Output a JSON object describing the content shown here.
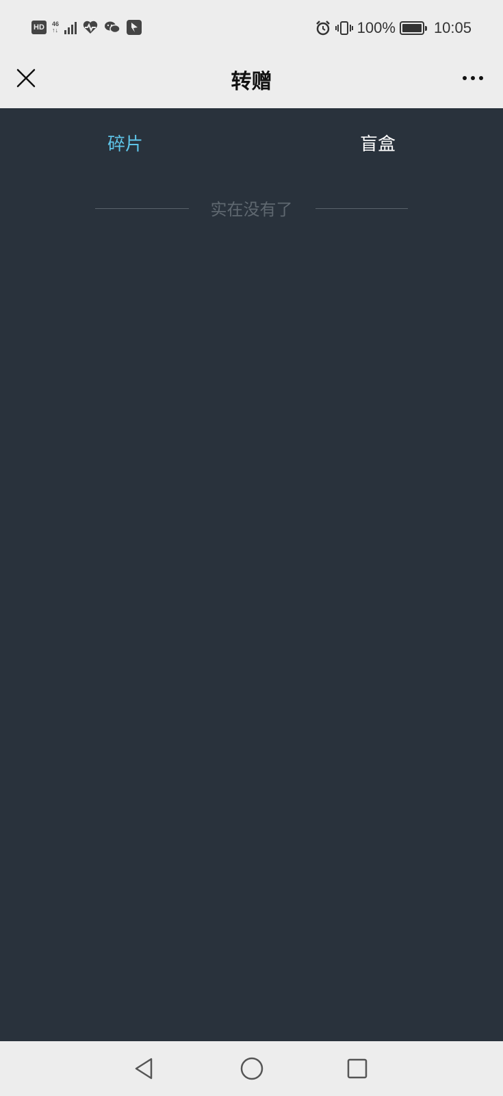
{
  "status_bar": {
    "hd": "HD",
    "network": "46",
    "network_sub": "↑↓",
    "battery_percent": "100%",
    "time": "10:05",
    "left_icons": [
      "hd-icon",
      "signal-icon",
      "health-icon",
      "wechat-icon",
      "app-icon"
    ],
    "right_icons": [
      "alarm-icon",
      "vibrate-icon",
      "battery-icon"
    ]
  },
  "header": {
    "title": "转赠",
    "close_icon": "close-icon",
    "more_icon": "more-icon"
  },
  "tabs": [
    {
      "label": "碎片",
      "active": true
    },
    {
      "label": "盲盒",
      "active": false
    }
  ],
  "empty_state": {
    "text": "实在没有了"
  },
  "colors": {
    "content_bg": "#29323c",
    "active_tab": "#5ec4e8",
    "inactive_tab": "#ffffff",
    "bar_bg": "#ededed"
  },
  "nav_bar": {
    "icons": [
      "back-icon",
      "home-icon",
      "recent-apps-icon"
    ]
  }
}
